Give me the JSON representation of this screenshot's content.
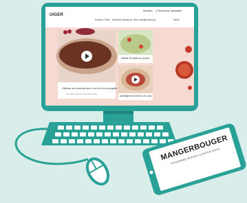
{
  "website": {
    "logo": "UIGER",
    "logo_subtitle": "",
    "topbar_links": [
      "Recettes",
      "Q Recherche",
      "Newsletter"
    ],
    "nav_items": [
      "Entrées",
      "Plats",
      "Desserts",
      "Boissons",
      "Bien manger",
      "Astuces",
      "Idées"
    ],
    "cards": [
      {
        "caption": "Gâteau au chocolat aux noix et à la courgette",
        "subcaption": "Des idées simples et gourmandes"
      },
      {
        "caption": "Salade de pâtes au poulet",
        "subcaption": ""
      },
      {
        "caption": "Aubergines et poivrons en curry",
        "subcaption": ""
      }
    ]
  },
  "tablet": {
    "title": "MANGERBOUGER",
    "subtitle": "PROGRAMME NATIONAL NUTRITION SANTÉ"
  },
  "colors": {
    "background": "#d9eeea",
    "device_teal": "#2aa197",
    "device_teal_dark": "#1e857c",
    "screen_pink": "#f6d9d0"
  },
  "icons": [
    "play-icon",
    "mouse-icon",
    "keyboard-icon",
    "tablet-icon",
    "tomato-icon",
    "bowl-icon",
    "cherry-icon"
  ]
}
